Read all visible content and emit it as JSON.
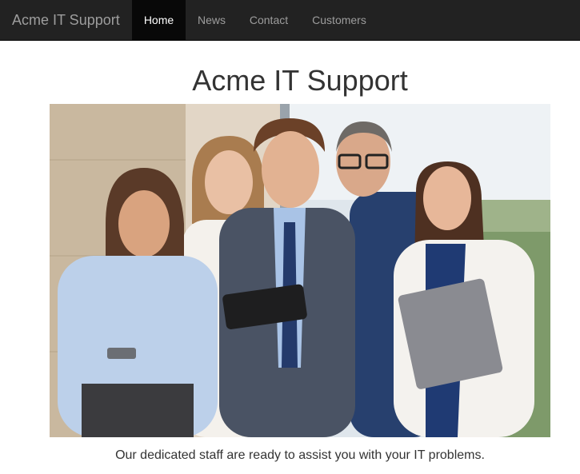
{
  "navbar": {
    "brand": "Acme IT Support",
    "items": [
      {
        "label": "Home",
        "active": true
      },
      {
        "label": "News",
        "active": false
      },
      {
        "label": "Contact",
        "active": false
      },
      {
        "label": "Customers",
        "active": false
      }
    ]
  },
  "main": {
    "title": "Acme IT Support",
    "caption": "Our dedicated staff are ready to assist you with your IT problems."
  },
  "colors": {
    "navbar_bg": "#222222",
    "nav_active_bg": "#080808",
    "nav_text": "#9d9d9d",
    "nav_active_text": "#ffffff",
    "body_text": "#333333"
  }
}
